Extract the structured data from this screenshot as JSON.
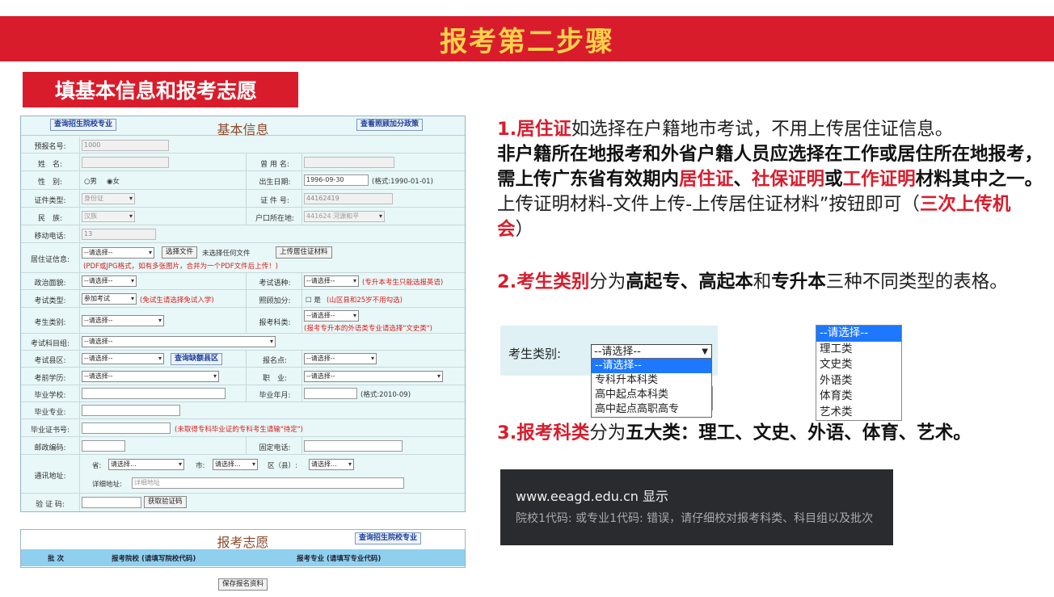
{
  "banner_title": "报考第二步骤",
  "subtitle": "填基本信息和报考志愿",
  "form": {
    "title": "基本信息",
    "query_school_btn": "查询招生院校专业",
    "policy_btn": "查看照顾加分政策",
    "fields": {
      "reg_no": {
        "label": "预报名号:",
        "value": "1000"
      },
      "name": {
        "label": "姓　名:"
      },
      "used_name": {
        "label": "曾 用 名:"
      },
      "gender": {
        "label": "性　别:",
        "male": "男",
        "female": "女"
      },
      "birth": {
        "label": "出生日期:",
        "value": "1996-09-30",
        "hint": "(格式:1990-01-01)"
      },
      "id_type": {
        "label": "证件类型:",
        "value": "身份证"
      },
      "id_no": {
        "label": "证 件 号:",
        "value": "44162419"
      },
      "ethnic": {
        "label": "民　族:",
        "value": "汉族"
      },
      "hukou": {
        "label": "户口所在地:",
        "value": "441624 河源和平"
      },
      "mobile": {
        "label": "移动电话:",
        "value": "13"
      },
      "residence": {
        "label": "居住证信息:",
        "select": "--请选择--",
        "choose_btn": "选择文件",
        "no_file": "未选择任何文件",
        "upload_btn": "上传居住证材料",
        "note": "(PDF或JPG格式，如有多张图片，合并为一个PDF文件后上传！)"
      },
      "politics": {
        "label": "政治面貌:",
        "value": "--请选择--"
      },
      "exam_lang": {
        "label": "考试语种:",
        "value": "--请选择--",
        "note": "(专升本考生只能选报英语)"
      },
      "exam_type": {
        "label": "考试类型:",
        "value": "参加考试",
        "note": "(免试生请选择免试入学)"
      },
      "bonus": {
        "label": "照顾加分:",
        "check": "是",
        "note": "(山区县和25岁不用勾选)"
      },
      "category": {
        "label": "考生类别:",
        "value": "--请选择--"
      },
      "subject_cat": {
        "label": "报考科类:",
        "value": "--请选择--",
        "note": "(报考专升本的外语类专业请选择\"文史类\")"
      },
      "subject_group": {
        "label": "考试科目组:",
        "value": "--请选择--"
      },
      "county": {
        "label": "考试县区:",
        "value": "--请选择--",
        "btn": "查询缺额县区"
      },
      "site": {
        "label": "报名点:",
        "value": "--请选择--"
      },
      "education": {
        "label": "考前学历:",
        "value": "--请选择--"
      },
      "job": {
        "label": "职　业:",
        "value": "--请选择--"
      },
      "grad_school": {
        "label": "毕业学校:"
      },
      "grad_year": {
        "label": "毕业年月:",
        "hint": "(格式:2010-09)"
      },
      "grad_major": {
        "label": "毕业专业:"
      },
      "cert_no": {
        "label": "毕业证书号:",
        "note": "(未取得专科毕业证的专科考生请输\"待定\")"
      },
      "postcode": {
        "label": "邮政编码:"
      },
      "phone": {
        "label": "固定电话:"
      },
      "address": {
        "label": "通讯地址:",
        "province": "省:",
        "province_val": "请选择...",
        "city": "市:",
        "city_val": "请选择...",
        "district": "区（县）:",
        "district_val": "请选择...",
        "detail": "详细地址:",
        "detail_placeholder": "详细地址"
      },
      "captcha": {
        "label": "验 证 码:",
        "btn": "获取验证码"
      }
    }
  },
  "wish": {
    "title": "报考志愿",
    "query_btn": "查询招生院校专业",
    "col_batch": "批 次",
    "col_school": "报考院校 (请填写院校代码)",
    "col_major": "报考专业 (请填写专业代码)",
    "save_btn": "保存报名资料"
  },
  "p1": {
    "n": "1.居住证",
    "a": "如选择在户籍地市考试，不用上传居住证信息。",
    "b": "非户籍所在地报考和外省户籍人员应选择在工作或居住所在地报考，需上传广东省有效期内",
    "r1": "居住证",
    "s1": "、",
    "r2": "社保证明",
    "s2": "或",
    "r3": "工作证明",
    "c": "材料其中之一。",
    "d": "上传证明材料-文件上传-上传居住证材料”按钮即可（",
    "r4": "三次上传机会",
    "e": "）"
  },
  "p2": {
    "n": "2.考生类别",
    "a": "分为",
    "b1": "高起专、高起本",
    "c": "和",
    "b2": "专升本",
    "d": "三种不同类型的表格。"
  },
  "category_demo": {
    "label": "考生类别:",
    "selected": "--请选择--",
    "options": [
      "--请选择--",
      "专科升本科类",
      "高中起点本科类",
      "高中起点高职高专"
    ]
  },
  "subject_demo": {
    "options": [
      "--请选择--",
      "理工类",
      "文史类",
      "外语类",
      "体育类",
      "艺术类"
    ]
  },
  "p3": {
    "n": "3.报考科类",
    "a": "分为",
    "b": "五大类：理工、文史、外语、体育、艺术。"
  },
  "dialog": {
    "title": "www.eeagd.edu.cn 显示",
    "message": "院校1代码:      或专业1代码:      错误，请仔细校对报考科类、科目组以及批次"
  }
}
